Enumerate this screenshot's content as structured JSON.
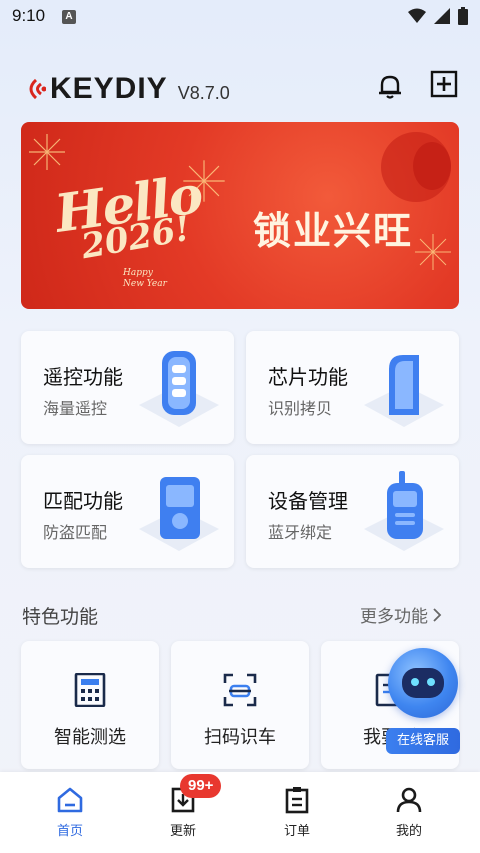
{
  "status_bar": {
    "time": "9:10",
    "notif_letter": "A"
  },
  "header": {
    "brand": "KEYDIY",
    "version": "V8.7.0"
  },
  "banner": {
    "hello": "Hello",
    "year": "2026!",
    "happy_line1": "Happy",
    "happy_line2": "New Year",
    "slogan": "锁业兴旺"
  },
  "cards": [
    {
      "title": "遥控功能",
      "subtitle": "海量遥控"
    },
    {
      "title": "芯片功能",
      "subtitle": "识别拷贝"
    },
    {
      "title": "匹配功能",
      "subtitle": "防盗匹配"
    },
    {
      "title": "设备管理",
      "subtitle": "蓝牙绑定"
    }
  ],
  "featured": {
    "title": "特色功能",
    "more": "更多功能",
    "items": [
      {
        "label": "智能测选",
        "icon": "calculator-icon"
      },
      {
        "label": "扫码识车",
        "icon": "scan-car-icon"
      },
      {
        "label": "我要返",
        "icon": "document-icon"
      }
    ]
  },
  "service": {
    "label": "在线客服"
  },
  "nav": {
    "items": [
      {
        "label": "首页",
        "icon": "home-icon",
        "active": true
      },
      {
        "label": "更新",
        "icon": "update-icon",
        "active": false
      },
      {
        "label": "订单",
        "icon": "order-icon",
        "active": false
      },
      {
        "label": "我的",
        "icon": "profile-icon",
        "active": false
      }
    ],
    "update_badge": "99+"
  },
  "colors": {
    "accent": "#2f6ae0",
    "banner_red": "#e33a26",
    "badge_red": "#e8382f"
  }
}
